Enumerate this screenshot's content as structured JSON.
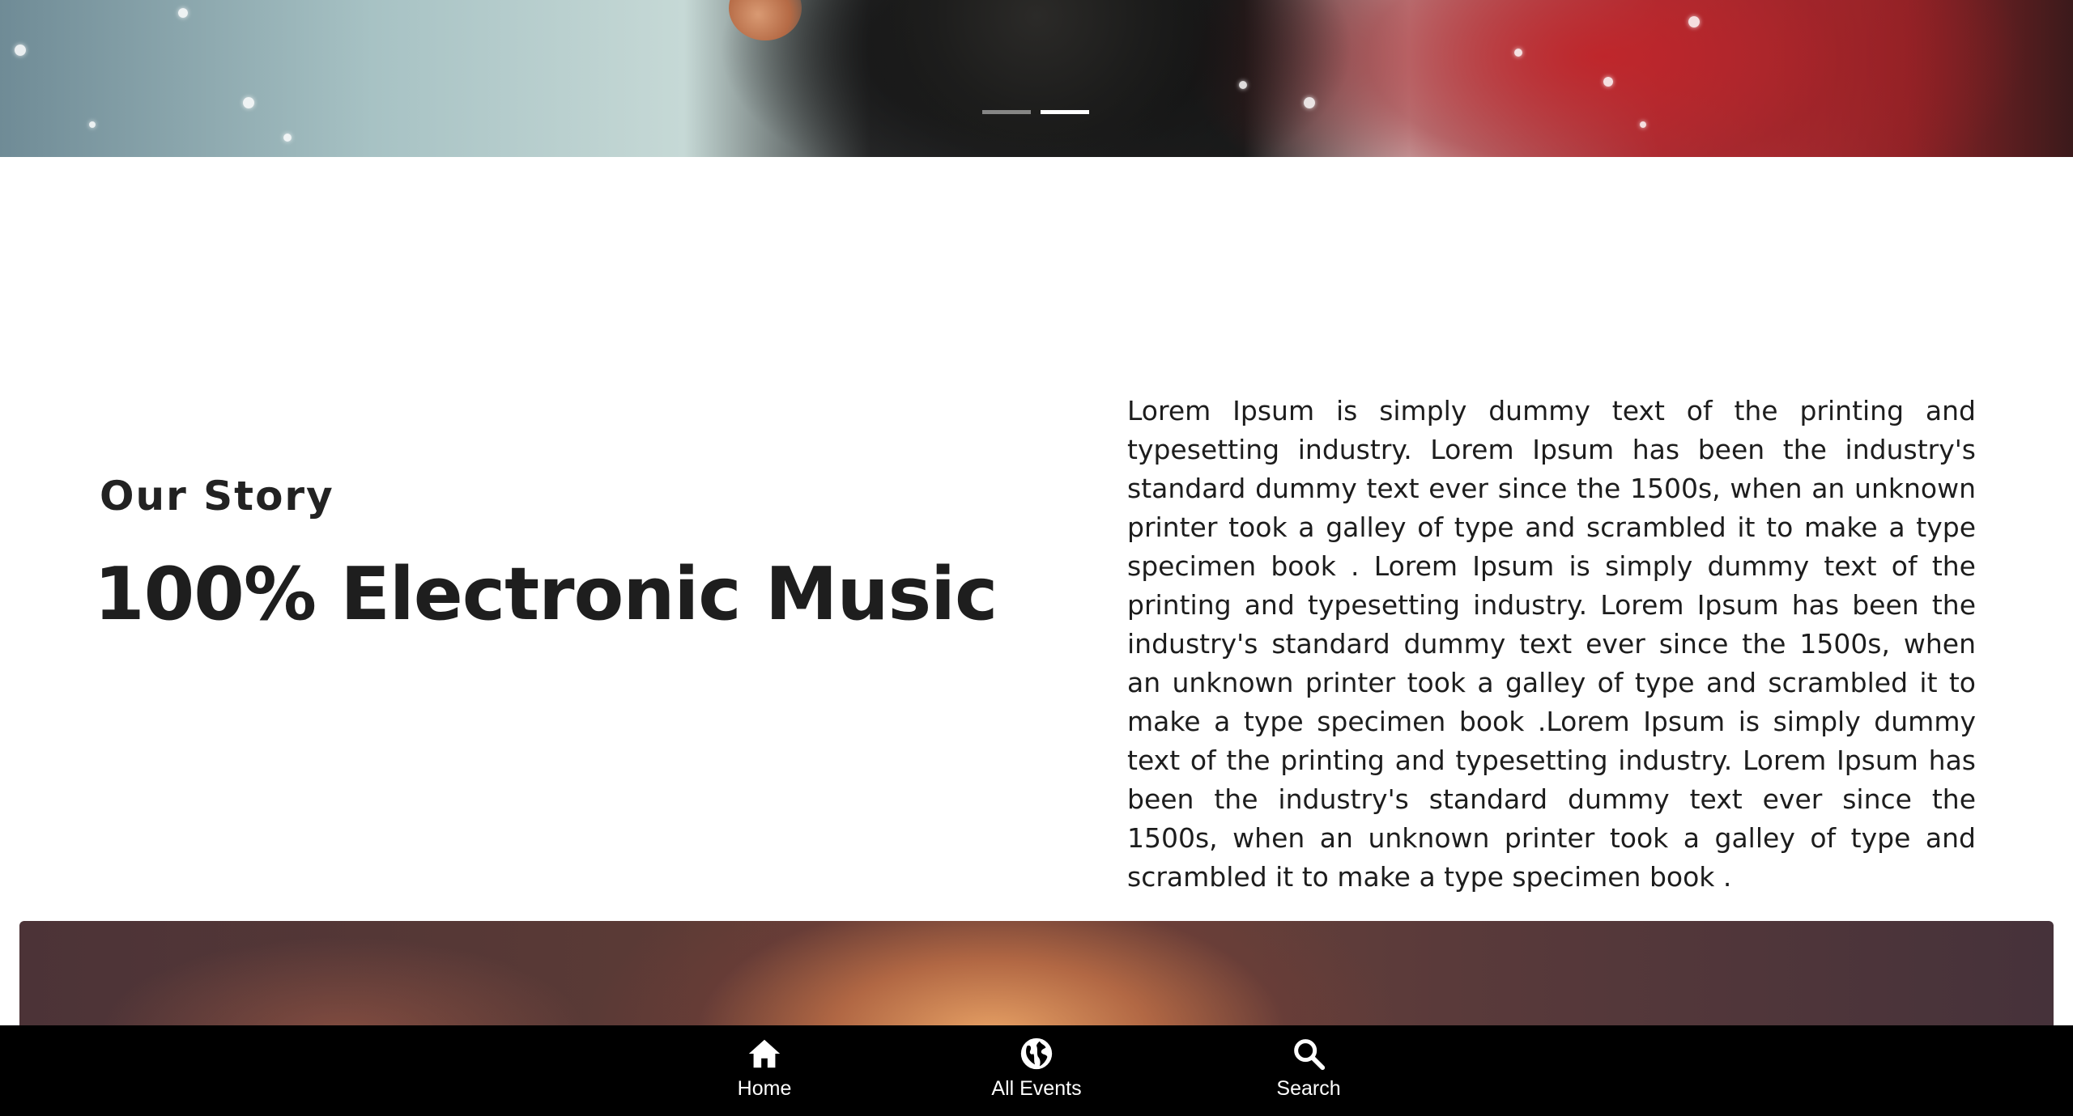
{
  "hero": {
    "slides": [
      {
        "active": false
      },
      {
        "active": true
      }
    ]
  },
  "story": {
    "subtitle": "Our Story",
    "headline": "100% Electronic Music",
    "paragraph": "Lorem Ipsum is simply dummy text of the printing and typesetting industry. Lorem Ipsum has been the industry's standard dummy text ever since the 1500s, when an unknown printer took a galley of type and scrambled it to make a type specimen book . Lorem Ipsum is simply dummy text of the printing and typesetting industry. Lorem Ipsum has been the industry's standard dummy text ever since the 1500s, when an unknown printer took a galley of type and scrambled it to make a type specimen book .Lorem Ipsum is simply dummy text of the printing and typesetting industry. Lorem Ipsum has been the industry's standard dummy text ever since the 1500s, when an unknown printer took a galley of type and scrambled it to make a type specimen book ."
  },
  "nav": {
    "items": [
      {
        "label": "Home",
        "icon": "home-icon"
      },
      {
        "label": "All Events",
        "icon": "globe-icon"
      },
      {
        "label": "Search",
        "icon": "search-icon"
      }
    ]
  },
  "colors": {
    "nav_background": "#000000",
    "text": "#1c1c1c",
    "indicator_active": "#ffffff"
  }
}
